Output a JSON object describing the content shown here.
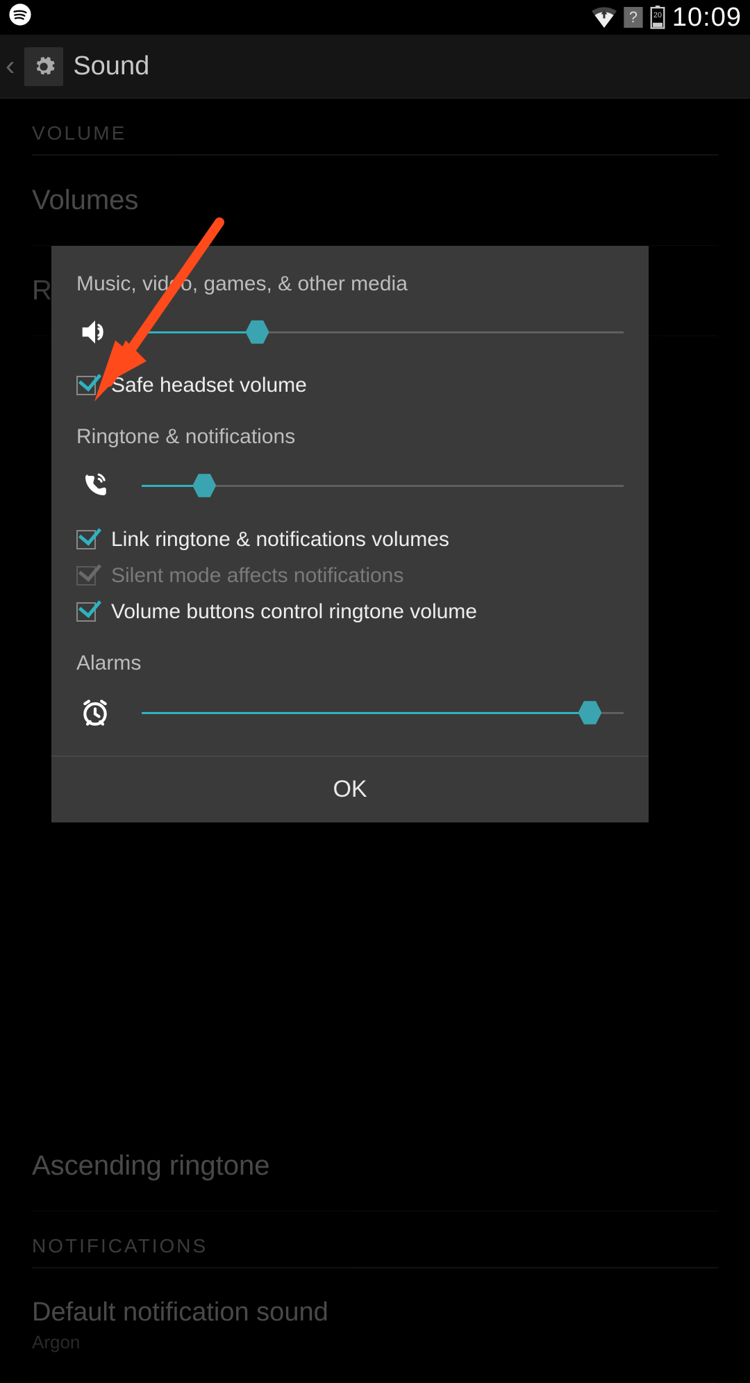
{
  "status": {
    "time": "10:09",
    "battery": "20"
  },
  "appbar": {
    "title": "Sound"
  },
  "bg": {
    "section_volume": "VOLUME",
    "volumes": "Volumes",
    "ring_mode": "Ring mode",
    "ascending": "Ascending ringtone",
    "section_notifications": "NOTIFICATIONS",
    "default_notif": "Default notification sound",
    "default_notif_sub": "Argon"
  },
  "dialog": {
    "media_label": "Music, video, games, & other media",
    "media_value": 24,
    "safe_headset": "Safe headset volume",
    "ring_label": "Ringtone & notifications",
    "ring_value": 13,
    "link_volumes": "Link ringtone & notifications volumes",
    "silent_mode": "Silent mode affects notifications",
    "volume_buttons": "Volume buttons control ringtone volume",
    "alarms_label": "Alarms",
    "alarms_value": 93,
    "ok": "OK"
  }
}
